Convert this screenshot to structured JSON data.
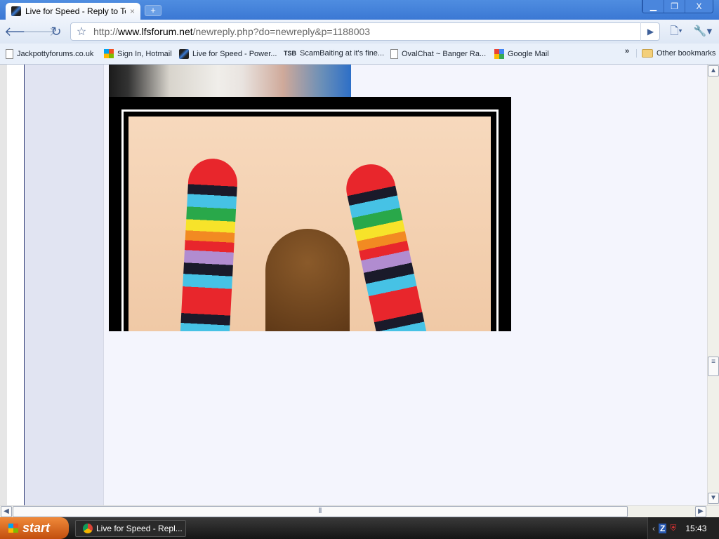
{
  "browser": {
    "tab": {
      "title": "Live for Speed - Reply to To...",
      "close": "×"
    },
    "new_tab": "+",
    "window_controls": {
      "minimize": "▁",
      "restore": "❐",
      "close": "X"
    },
    "url_prefix": "http://",
    "url_domain": "www.lfsforum.net",
    "url_path": "/newreply.php?do=newreply&p=1188003",
    "bookmarks": [
      {
        "label": "Jackpottyforums.co.uk",
        "icon": "page-icon"
      },
      {
        "label": "Sign In, Hotmail",
        "icon": "windows-icon"
      },
      {
        "label": "Live for Speed - Power...",
        "icon": "lfs-icon"
      },
      {
        "label": "ScamBaiting at it's fine...",
        "icon": "tsb-icon"
      },
      {
        "label": "OvalChat ~ Banger Ra...",
        "icon": "page-icon"
      },
      {
        "label": "Google Mail",
        "icon": "gmail-icon"
      }
    ],
    "bookmarks_overflow": "»",
    "other_bookmarks": "Other bookmarks",
    "tsb_glyph": "TSB"
  },
  "taskbar": {
    "start": "start",
    "task": "Live for Speed - Repl...",
    "clock": "15:43"
  }
}
